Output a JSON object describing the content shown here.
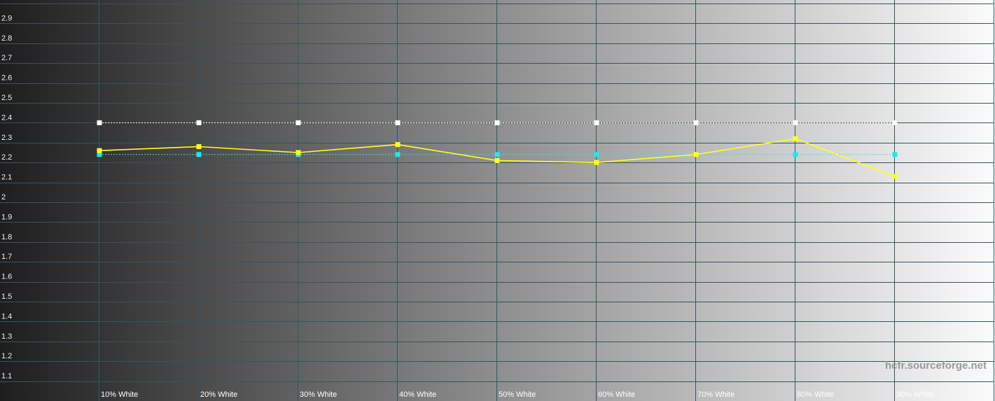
{
  "chart_data": {
    "type": "line",
    "categories": [
      "10% White",
      "20% White",
      "30% White",
      "40% White",
      "50% White",
      "60% White",
      "70% White",
      "80% White",
      "90% White"
    ],
    "series": [
      {
        "values": [
          2.26,
          2.28,
          2.25,
          2.29,
          2.21,
          2.2,
          2.24,
          2.32,
          2.13
        ],
        "color": "#ffff1e",
        "style": "solid"
      },
      {
        "values": [
          2.24,
          2.24,
          2.24,
          2.24,
          2.24,
          2.24,
          2.24,
          2.24,
          2.24
        ],
        "color": "#22e6f0",
        "style": "dashed"
      },
      {
        "values": [
          2.4,
          2.4,
          2.4,
          2.4,
          2.4,
          2.4,
          2.4,
          2.4,
          2.4
        ],
        "color": "#ffffff",
        "style": "dashed"
      }
    ],
    "yticks": [
      "1.1",
      "1.2",
      "1.3",
      "1.4",
      "1.5",
      "1.6",
      "1.7",
      "1.8",
      "1.9",
      "2",
      "2.1",
      "2.2",
      "2.3",
      "2.4",
      "2.5",
      "2.6",
      "2.7",
      "2.8",
      "2.9"
    ],
    "ylim": [
      1.0,
      3.0
    ],
    "title": "",
    "xlabel": "",
    "ylabel": "",
    "grid": true,
    "grid_color": "#2c5a5c",
    "background": "horizontal grayscale gradient, dark left to white right",
    "watermark": "hcfr.sourceforge.net"
  }
}
